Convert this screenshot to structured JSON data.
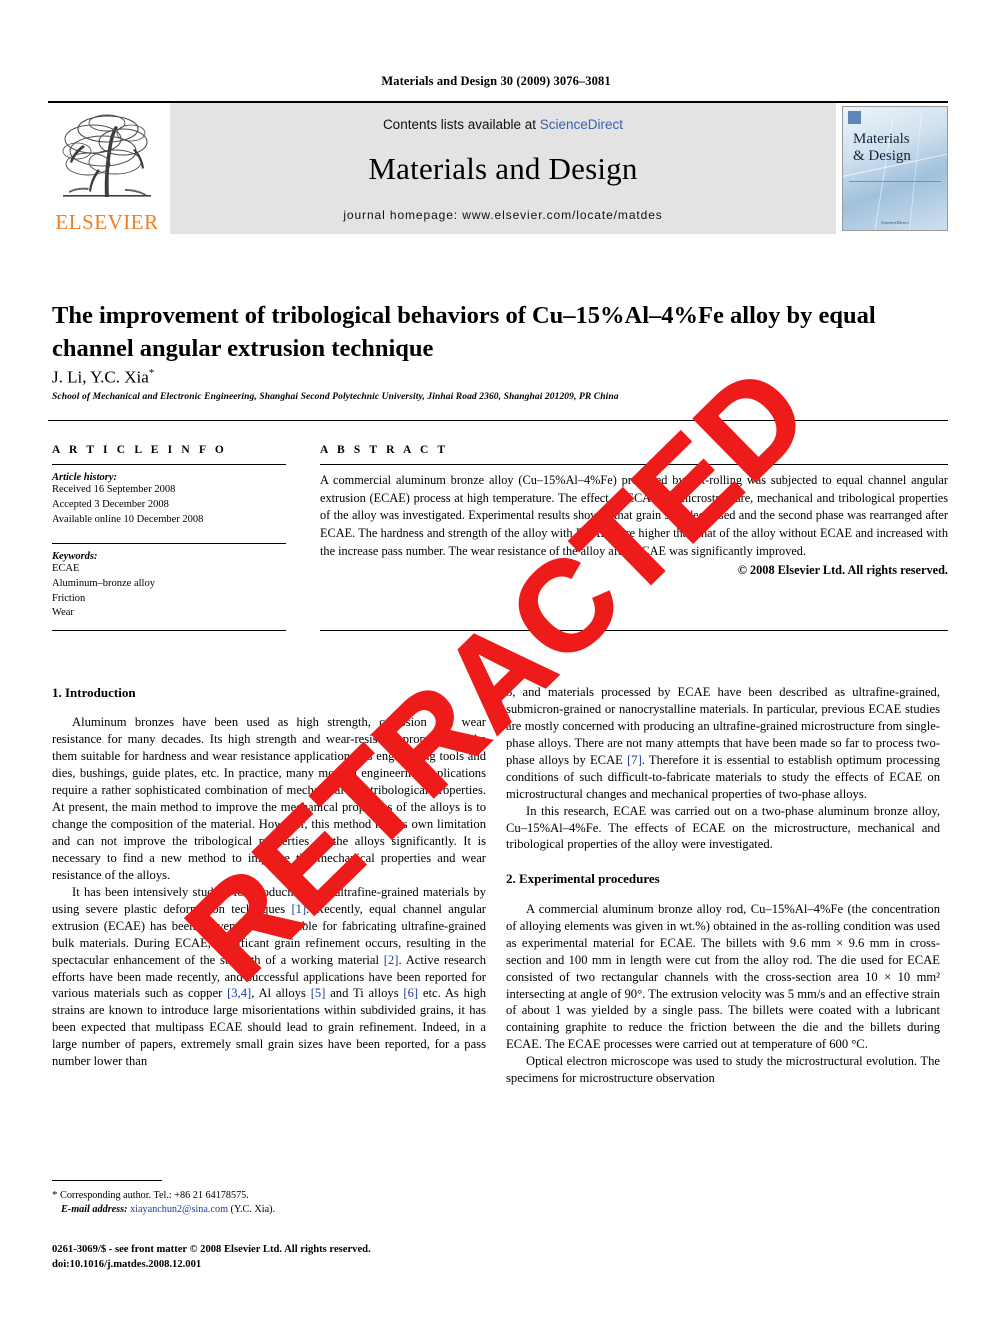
{
  "running_head": "Materials and Design 30 (2009) 3076–3081",
  "banner": {
    "publisher_name": "ELSEVIER",
    "contents_prefix": "Contents lists available at ",
    "sciencedirect": "ScienceDirect",
    "journal_title": "Materials and Design",
    "homepage": "journal homepage: www.elsevier.com/locate/matdes",
    "cover": {
      "line1": "Materials",
      "line2": "& Design",
      "footer": "ScienceDirect"
    }
  },
  "article": {
    "title": "The improvement of tribological behaviors of Cu–15%Al–4%Fe alloy by equal channel angular extrusion technique",
    "authors": "J. Li, Y.C. Xia",
    "author_marker": "*",
    "affiliation": "School of Mechanical and Electronic Engineering, Shanghai Second Polytechnic University, Jinhai Road 2360, Shanghai 201209, PR China"
  },
  "article_info": {
    "heading": "A R T I C L E   I N F O",
    "history_label": "Article history:",
    "history": [
      "Received 16 September 2008",
      "Accepted 3 December 2008",
      "Available online 10 December 2008"
    ],
    "keywords_label": "Keywords:",
    "keywords": [
      "ECAE",
      "Aluminum–bronze alloy",
      "Friction",
      "Wear"
    ]
  },
  "abstract": {
    "heading": "A B S T R A C T",
    "text": "A commercial aluminum bronze alloy (Cu–15%Al–4%Fe) produced by hot-rolling was subjected to equal channel angular extrusion (ECAE) process at high temperature. The effect of ECAE on microstructure, mechanical and tribological properties of the alloy was investigated. Experimental results showed that grain size decreased and the second phase was rearranged after ECAE. The hardness and strength of the alloy with ECAE were higher than that of the alloy without ECAE and increased with the increase pass number. The wear resistance of the alloy after ECAE was significantly improved.",
    "copyright": "© 2008 Elsevier Ltd. All rights reserved."
  },
  "body": {
    "introduction_heading": "1. Introduction",
    "intro_p1": "Aluminum bronzes have been used as high strength, corrosion and wear resistance for many decades. Its high strength and wear-resisting properties make them suitable for hardness and wear resistance applications, as engineering tools and dies, bushings, guide plates, etc. In practice, many modern engineering applications require a rather sophisticated combination of mechanical and tribological properties. At present, the main method to improve the mechanical properties of the alloys is to change the composition of the material. However, this method has its own limitation and can not improve the tribological properties of the alloys significantly. It is necessary to find a new method to improve the mechanical properties and wear resistance of the alloys.",
    "intro_p2_a": "It has been intensively studied for producing bulk ultrafine-grained materials by using severe plastic deformation techniques ",
    "intro_p2_r1": "[1]",
    "intro_p2_b": ". Recently, equal channel angular extrusion (ECAE) has been proven to be available for fabricating ultrafine-grained bulk materials. During ECAE, significant grain refinement occurs, resulting in the spectacular enhancement of the strength of a working material ",
    "intro_p2_r2": "[2]",
    "intro_p2_c": ". Active research efforts have been made recently, and successful applications have been reported for various materials such as copper ",
    "intro_p2_r3": "[3,4]",
    "intro_p2_d": ", Al alloys ",
    "intro_p2_r4": "[5]",
    "intro_p2_e": " and Ti alloys ",
    "intro_p2_r5": "[6]",
    "intro_p2_f": " etc. As high strains are known to introduce large misorientations within subdivided grains, it has been expected that multipass ECAE should lead to grain refinement. Indeed, in a large number of papers, extremely small grain sizes have been reported, for a pass number lower than",
    "col2_p1_a": "8, and materials processed by ECAE have been described as ultrafine-grained, submicron-grained or nanocrystalline materials. In particular, previous ECAE studies are mostly concerned with producing an ultrafine-grained microstructure from single-phase alloys. There are not many attempts that have been made so far to process two-phase alloys by ECAE ",
    "col2_p1_r1": "[7]",
    "col2_p1_b": ". Therefore it is essential to establish optimum processing conditions of such difficult-to-fabricate materials to study the effects of ECAE on microstructural changes and mechanical properties of two-phase alloys.",
    "col2_p2": "In this research, ECAE was carried out on a two-phase aluminum bronze alloy, Cu–15%Al–4%Fe. The effects of ECAE on the microstructure, mechanical and tribological properties of the alloy were investigated.",
    "experimental_heading": "2. Experimental procedures",
    "exp_p1": "A commercial aluminum bronze alloy rod, Cu–15%Al–4%Fe (the concentration of alloying elements was given in wt.%) obtained in the as-rolling condition was used as experimental material for ECAE. The billets with 9.6 mm × 9.6 mm in cross-section and 100 mm in length were cut from the alloy rod. The die used for ECAE consisted of two rectangular channels with the cross-section area 10 × 10 mm² intersecting at angle of 90°. The extrusion velocity was 5 mm/s and an effective strain of about 1 was yielded by a single pass. The billets were coated with a lubricant containing graphite to reduce the friction between the die and the billets during ECAE. The ECAE processes were carried out at temperature of 600 °C.",
    "exp_p2": "Optical electron microscope was used to study the microstructural evolution. The specimens for microstructure observation"
  },
  "footnote": {
    "marker": "*",
    "corresponding": " Corresponding author. Tel.: +86 21 64178575.",
    "email_label": "E-mail address:",
    "email": "xiayanchun2@sina.com",
    "email_suffix": " (Y.C. Xia)."
  },
  "imprint": {
    "line1": "0261-3069/$ - see front matter © 2008 Elsevier Ltd. All rights reserved.",
    "line2": "doi:10.1016/j.matdes.2008.12.001"
  },
  "watermark": {
    "text": "RETRACTED",
    "color": "#ee1b1b"
  }
}
